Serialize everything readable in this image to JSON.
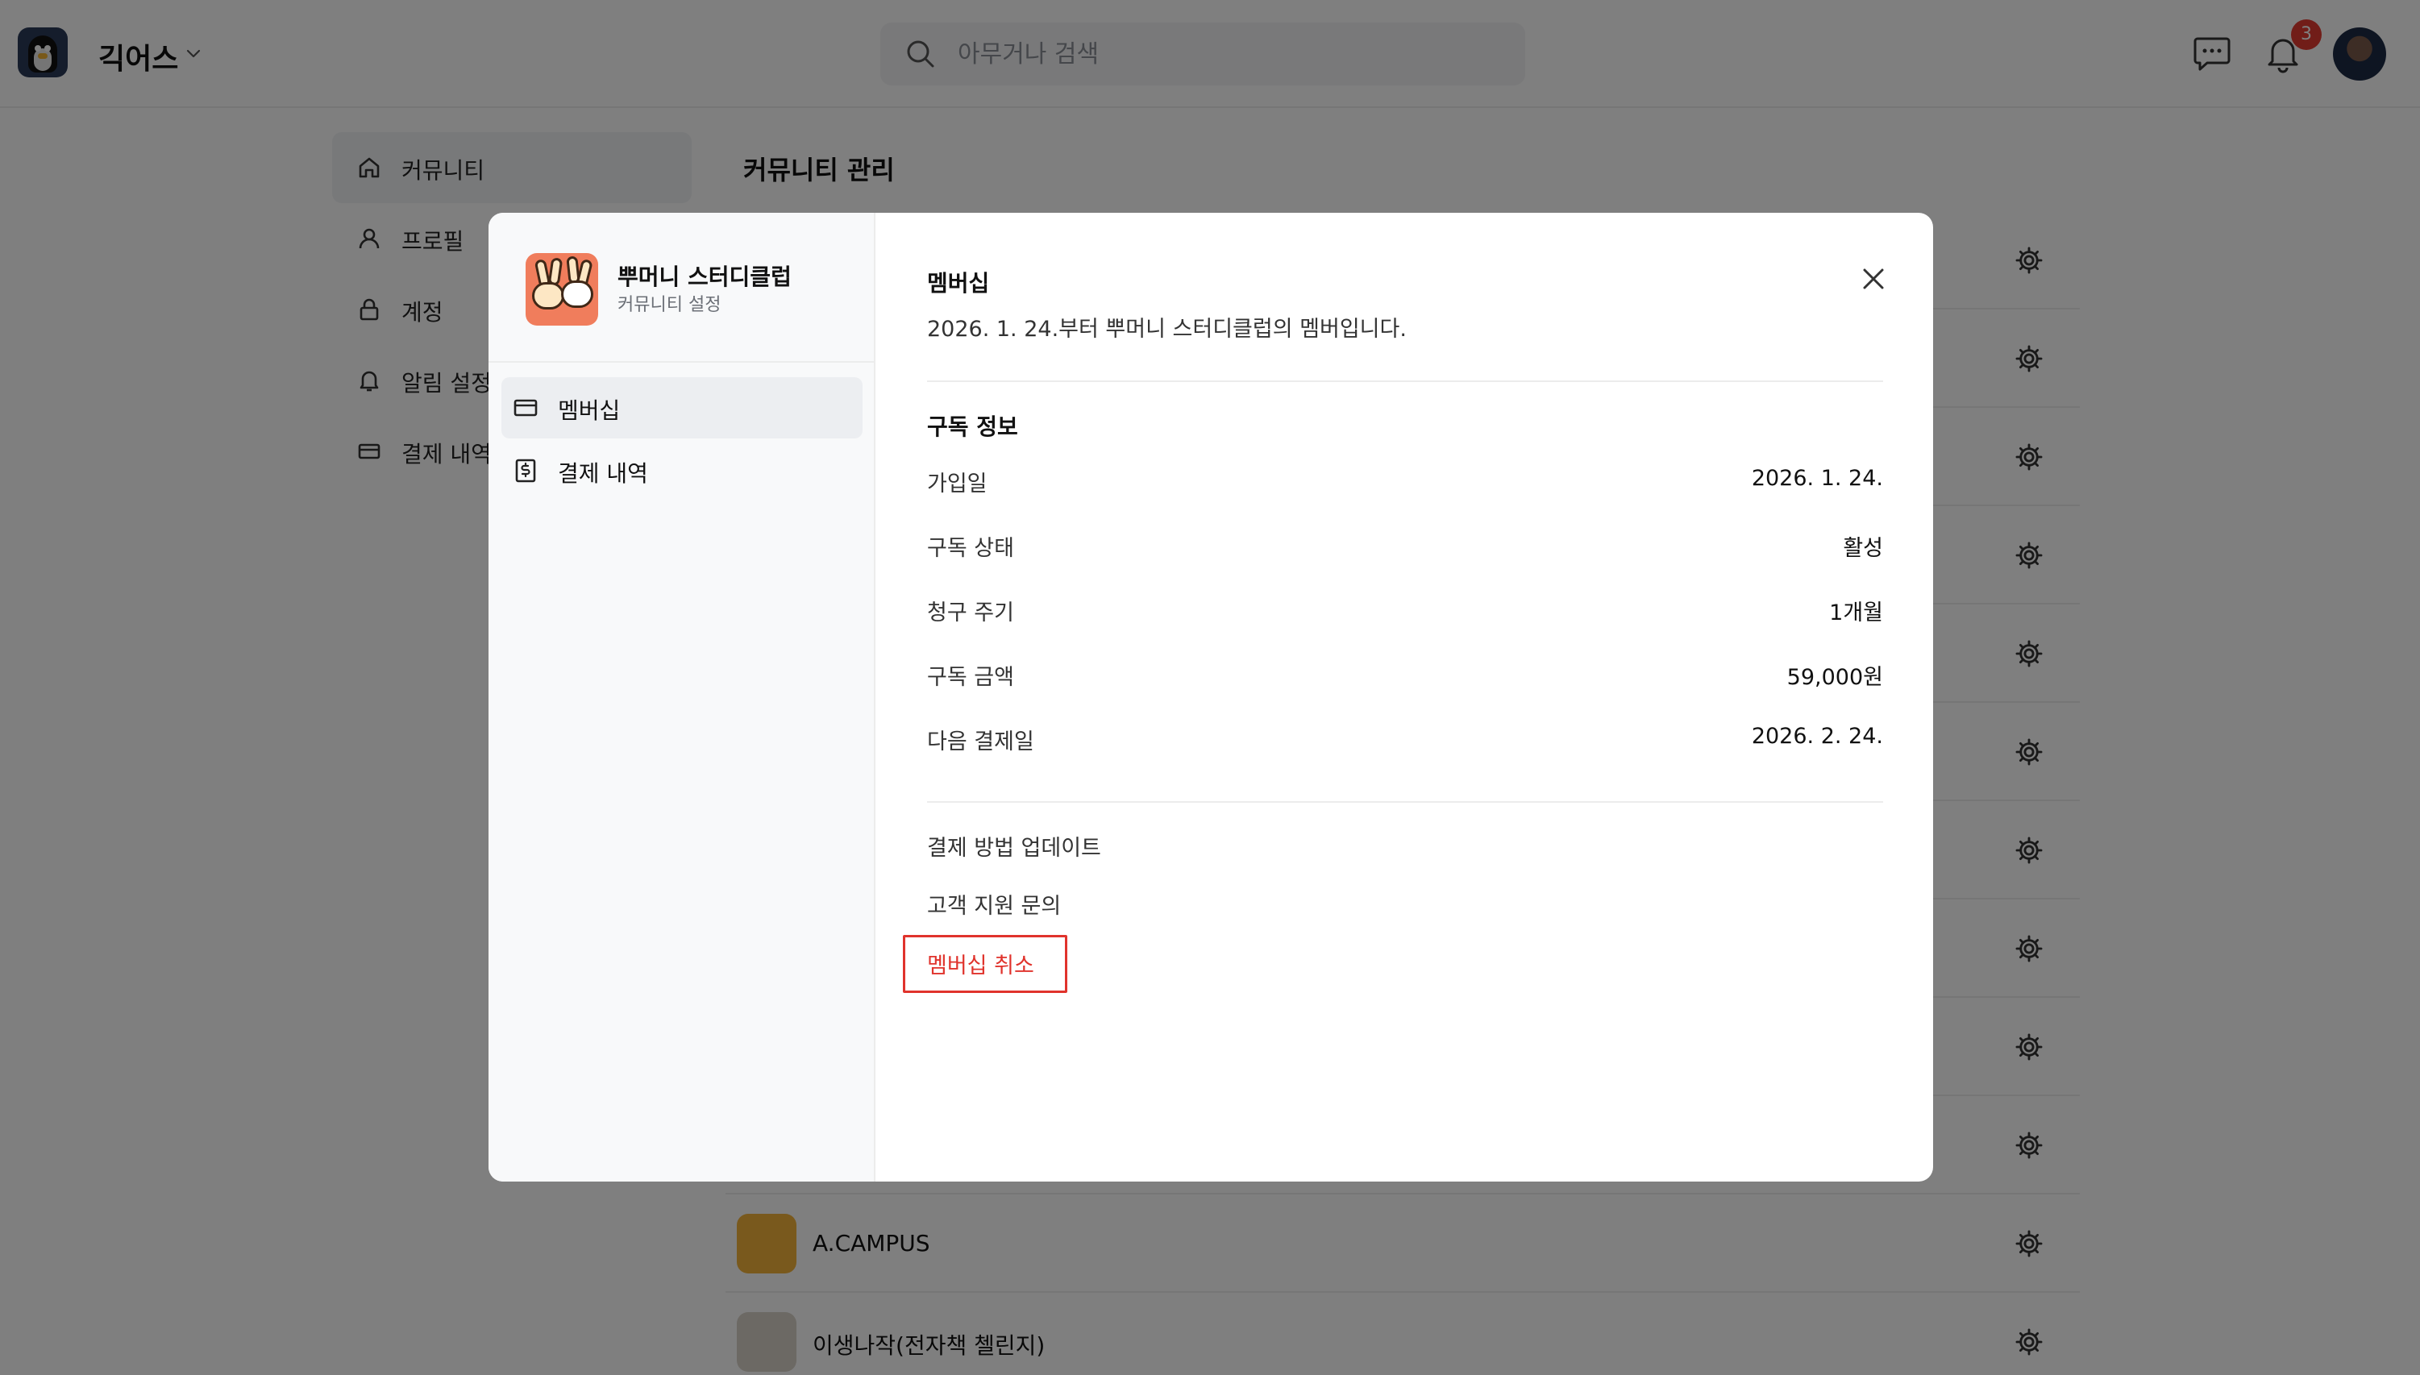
{
  "topbar": {
    "workspace_name": "긱어스",
    "search_placeholder": "아무거나 검색",
    "notification_count": "3",
    "icons": [
      "penguin-logo",
      "chevron-down-icon",
      "search-icon",
      "chat-icon",
      "bell-icon",
      "avatar"
    ]
  },
  "sidebar": {
    "items": [
      {
        "label": "커뮤니티",
        "icon": "home-icon"
      },
      {
        "label": "프로필",
        "icon": "person-icon"
      },
      {
        "label": "계정",
        "icon": "lock-icon"
      },
      {
        "label": "알림 설정",
        "icon": "bell-icon"
      },
      {
        "label": "결제 내역",
        "icon": "card-icon"
      }
    ]
  },
  "background": {
    "title": "커뮤니티 관리",
    "communities": [
      {
        "name": "A.CAMPUS",
        "thumb_color": "#f2b33a"
      },
      {
        "name": "이생나작(전자책 첼린지)",
        "thumb_color": "#d8d2c8"
      }
    ]
  },
  "modal": {
    "community_name": "뿌머니 스터디클럽",
    "community_sub": "커뮤니티 설정",
    "nav": [
      {
        "label": "멤버십",
        "icon": "card-icon",
        "active": true
      },
      {
        "label": "결제 내역",
        "icon": "receipt-dollar-icon",
        "active": false
      }
    ],
    "title": "멤버십",
    "description": "2026. 1. 24.부터 뿌머니 스터디클럽의 멤버입니다.",
    "section_title": "구독 정보",
    "rows": [
      {
        "key": "가입일",
        "value": "2026. 1. 24."
      },
      {
        "key": "구독 상태",
        "value": "활성"
      },
      {
        "key": "청구 주기",
        "value": "1개월"
      },
      {
        "key": "구독 금액",
        "value": "59,000원"
      },
      {
        "key": "다음 결제일",
        "value": "2026. 2. 24."
      }
    ],
    "actions": {
      "update_payment": "결제 방법 업데이트",
      "support": "고객 지원 문의",
      "cancel": "멤버십 취소"
    },
    "colors": {
      "danger": "#e0332c",
      "overlay": "rgba(0,0,0,0.5)"
    }
  }
}
